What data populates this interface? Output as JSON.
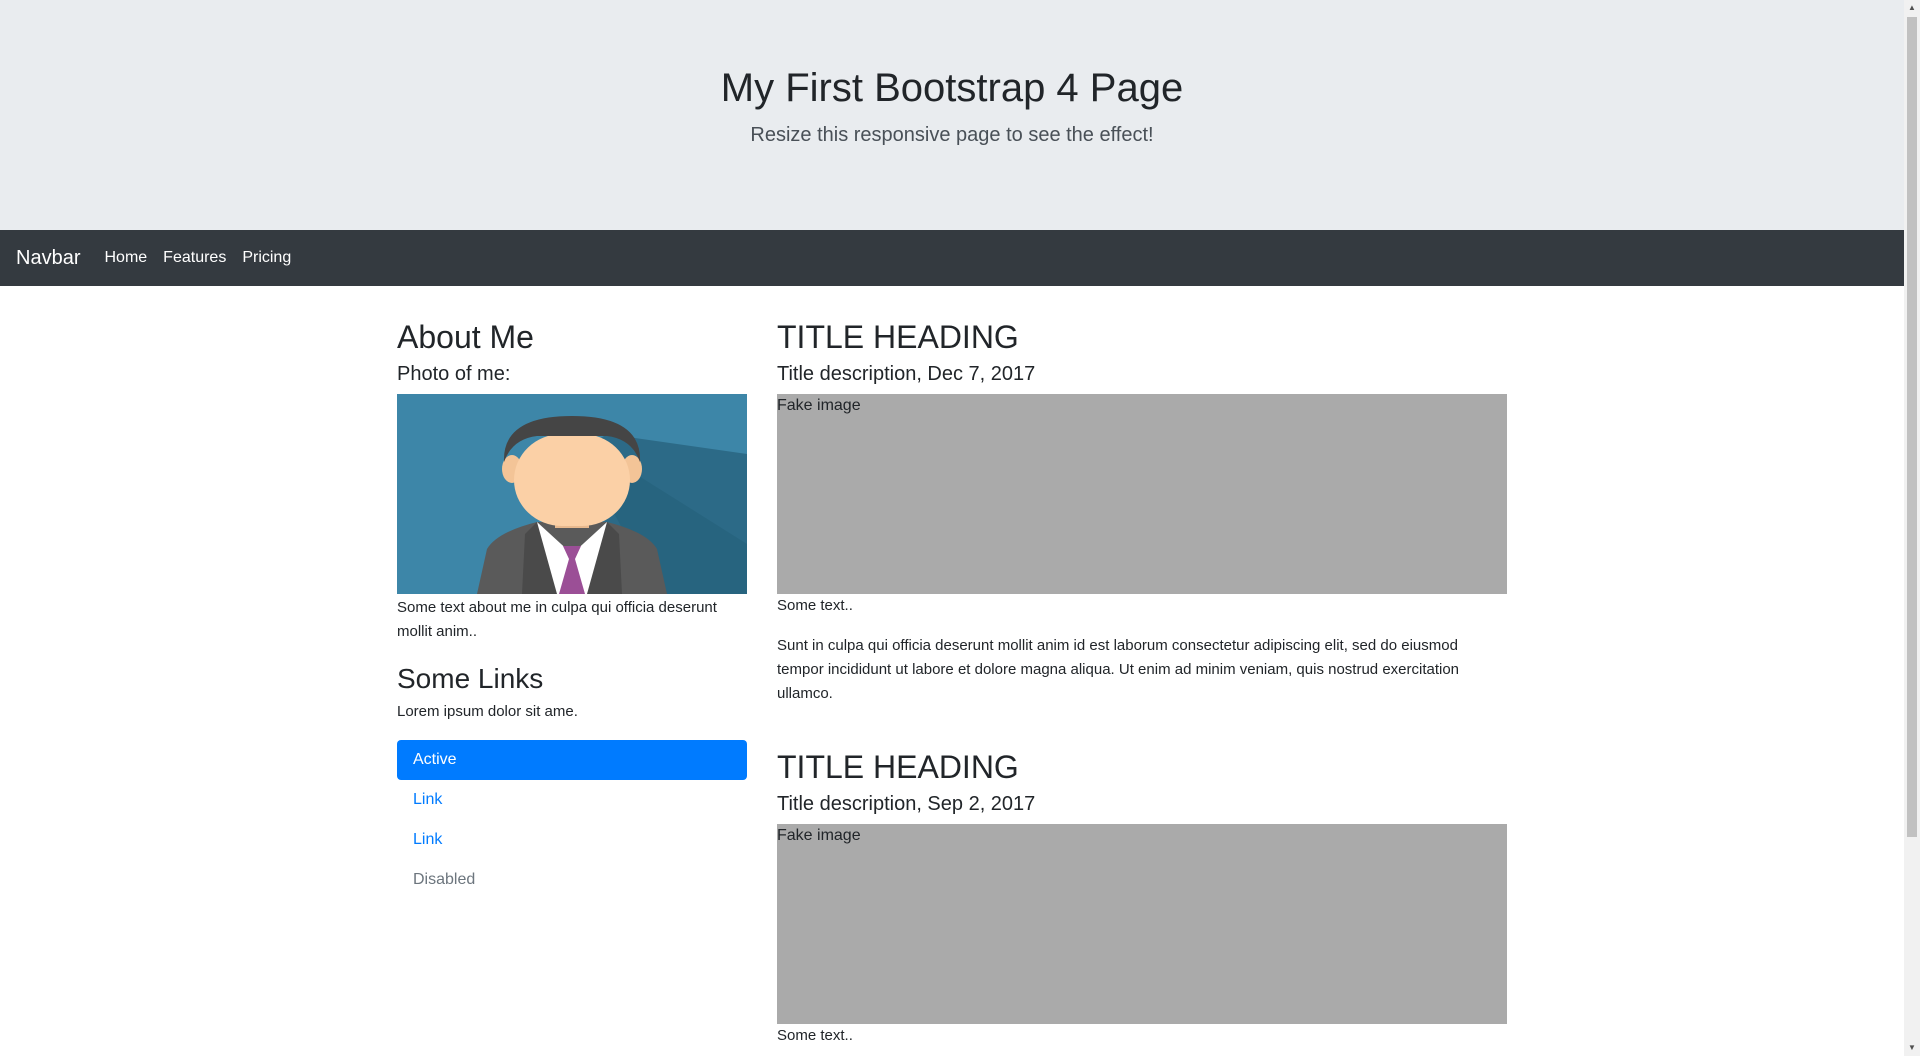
{
  "jumbotron": {
    "title": "My First Bootstrap 4 Page",
    "subtitle": "Resize this responsive page to see the effect!"
  },
  "navbar": {
    "brand": "Navbar",
    "links": [
      "Home",
      "Features",
      "Pricing"
    ]
  },
  "about": {
    "heading": "About Me",
    "photo_label": "Photo of me:",
    "text": "Some text about me in culpa qui officia deserunt mollit anim.."
  },
  "links_section": {
    "heading": "Some Links",
    "text": "Lorem ipsum dolor sit ame.",
    "items": [
      "Active",
      "Link",
      "Link",
      "Disabled"
    ]
  },
  "posts": [
    {
      "heading": "TITLE HEADING",
      "description": "Title description, Dec 7, 2017",
      "image_label": "Fake image",
      "short_text": "Some text..",
      "long_text": "Sunt in culpa qui officia deserunt mollit anim id est laborum consectetur adipiscing elit, sed do eiusmod tempor incididunt ut labore et dolore magna aliqua. Ut enim ad minim veniam, quis nostrud exercitation ullamco."
    },
    {
      "heading": "TITLE HEADING",
      "description": "Title description, Sep 2, 2017",
      "image_label": "Fake image",
      "short_text": "Some text.."
    }
  ],
  "colors": {
    "jumbotron_bg": "#e9ecef",
    "navbar_bg": "#343a40",
    "accent": "#007bff",
    "fake_image_bg": "#aaaaaa",
    "muted": "#6c757d"
  },
  "icons": {
    "scroll_up": "triangle-up-icon",
    "scroll_down": "triangle-down-icon"
  }
}
